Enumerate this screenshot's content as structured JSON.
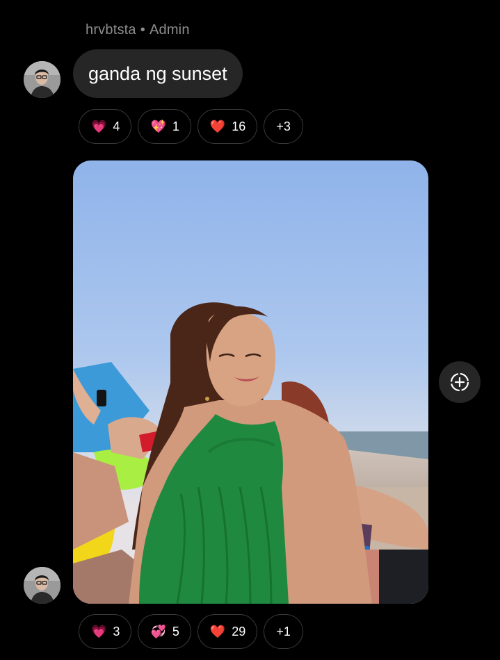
{
  "message1": {
    "sender": "hrvbtsta",
    "role": "Admin",
    "separator": "•",
    "text": "ganda ng sunset",
    "reactions": [
      {
        "emoji": "💗",
        "icon": "growing-heart-icon",
        "count": "4"
      },
      {
        "emoji": "💖",
        "icon": "sparkling-heart-icon",
        "count": "1"
      },
      {
        "emoji": "❤️",
        "icon": "red-heart-icon",
        "count": "16"
      }
    ],
    "more_reactions": "+3"
  },
  "message2": {
    "type": "photo",
    "reactions": [
      {
        "emoji": "💗",
        "icon": "growing-heart-icon",
        "count": "3"
      },
      {
        "emoji": "💞",
        "icon": "revolving-hearts-icon",
        "count": "5"
      },
      {
        "emoji": "❤️",
        "icon": "red-heart-icon",
        "count": "29"
      }
    ],
    "more_reactions": "+1"
  },
  "colors": {
    "background": "#000000",
    "bubble": "#262626",
    "sender_text": "#8e8e8e",
    "pill_border": "#3a3a3a"
  }
}
